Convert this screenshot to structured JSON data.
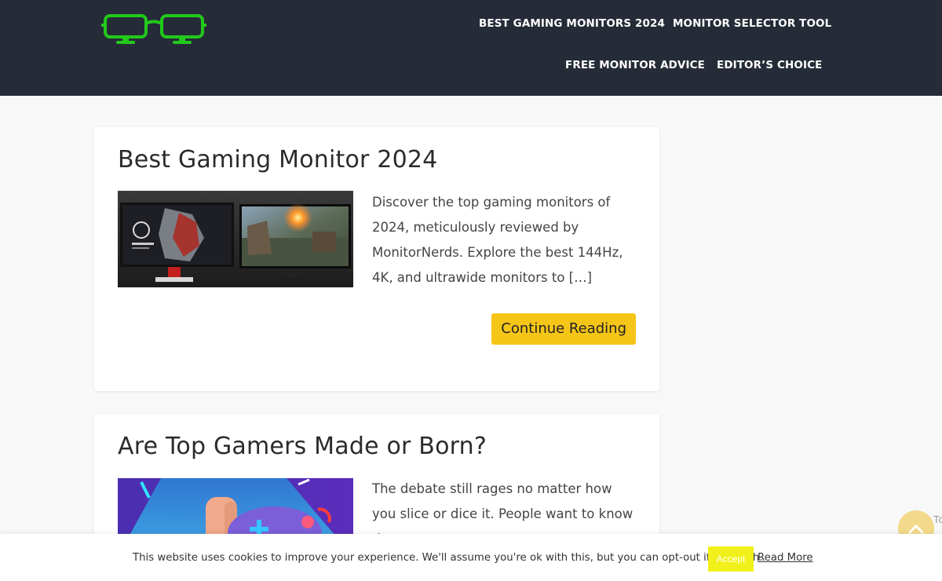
{
  "header": {
    "logo_icon": "glasses-monitor-logo-icon",
    "accent_color": "#22c91b",
    "background_color": "#262b38",
    "nav": [
      {
        "label": "BEST GAMING MONITORS 2024"
      },
      {
        "label": "MONITOR SELECTOR TOOL"
      },
      {
        "label": "FREE MONITOR ADVICE"
      },
      {
        "label": "EDITOR’S CHOICE"
      }
    ]
  },
  "articles": [
    {
      "title": "Best Gaming Monitor 2024",
      "excerpt": "Discover the top gaming monitors of 2024, meticulously reviewed by MonitorNerds. Explore the best 144Hz, 4K, and ultrawide monitors to […]",
      "button_label": "Continue Reading",
      "thumbnail": "gaming-monitors-thumbnail"
    },
    {
      "title": "Are Top Gamers Made or Born?",
      "excerpt": "The debate still rages no matter how you slice or dice it. People want to know the",
      "thumbnail": "gamer-controller-thumbnail"
    }
  ],
  "button_color": "#f5c518",
  "scroll_top": {
    "icon": "chevron-up-icon",
    "label": "To"
  },
  "cookie_bar": {
    "text": "This website uses cookies to improve your experience. We'll assume you're ok with this, but you can opt-out if you wish.",
    "accept_label": "Accept",
    "read_more_label": "Read More",
    "accept_color": "#f2f01a"
  }
}
